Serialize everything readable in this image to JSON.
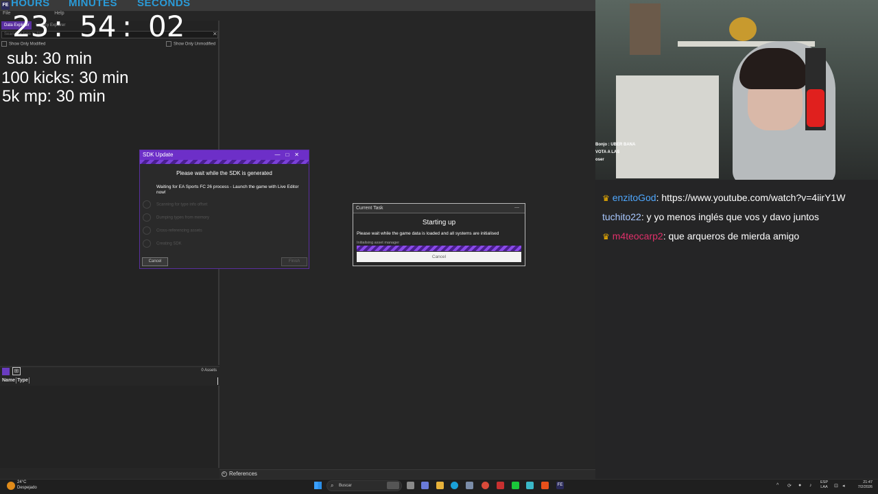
{
  "editor": {
    "menu": [
      "File",
      "Help"
    ],
    "tabs": {
      "data_explorer": "Data Explorer",
      "legacy_explorer": "Legacy Explorer"
    },
    "search_placeholder": "Search or type to filter",
    "filters": {
      "show_only_modified": "Show Only Modified",
      "show_only_unmodified": "Show Only Unmodified"
    },
    "assets": {
      "count": "0 Assets",
      "columns": [
        "Name",
        "Type"
      ]
    },
    "references": "References"
  },
  "overlay": {
    "timer_labels": {
      "hours": "HOURS",
      "minutes": "MINUTES",
      "seconds": "SECONDS"
    },
    "timer": {
      "hours": "23",
      "minutes": "54",
      "seconds": "02",
      "sep": ":"
    },
    "lines": [
      "sub: 30 min",
      "100 kicks: 30 min",
      "5k mp: 30 min"
    ]
  },
  "sdk_dialog": {
    "title": "SDK Update",
    "controls": [
      "—",
      "□",
      "✕"
    ],
    "heading": "Please wait while the SDK is generated",
    "waiting": "Waiting for EA Sports FC 26 process - Launch the game with Live Editor now!",
    "steps": [
      "Scanning for type info offset",
      "Dumping types from memory",
      "Cross-referencing assets",
      "Creating SDK"
    ],
    "cancel": "Cancel",
    "finish": "Finish"
  },
  "task_dialog": {
    "title": "Current Task",
    "minimize": "—",
    "heading": "Starting up",
    "text": "Please wait while the game data is loaded and all systems are initialised",
    "sub": "Initialising asset manager",
    "cancel": "Cancel"
  },
  "webcam": {
    "caption_lines": [
      "Bonjo : UBER BANA",
      "VOTA A LAS",
      "oser"
    ]
  },
  "chat": [
    {
      "user": "enzitoGod",
      "user_color": "#4fa8ff",
      "crown": true,
      "message": ": https://www.youtube.com/watch?v=4iirY1W"
    },
    {
      "user": "tuchito22",
      "user_color": "#a9c8ff",
      "crown": false,
      "message": ": y yo menos inglés que vos y davo juntos"
    },
    {
      "user": "m4teocarp2",
      "user_color": "#e0306a",
      "crown": true,
      "message": ": que arqueros de mierda amigo"
    }
  ],
  "taskbar": {
    "weather_temp": "24°C",
    "weather_desc": "Despejado",
    "search": "Buscar",
    "lang": [
      "ESP",
      "LAA"
    ],
    "time": "21:47",
    "date": "7/2/2026"
  },
  "colors": {
    "accent": "#6d2fc8",
    "timer_label": "#2a9bd8",
    "crown": "#f5b400"
  }
}
